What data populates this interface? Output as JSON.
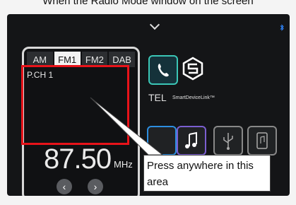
{
  "caption": "When the Radio Mode window on the screen",
  "radio": {
    "bands": [
      "AM",
      "FM1",
      "FM2",
      "DAB"
    ],
    "active_band": "FM1",
    "preset": "P.CH 1",
    "frequency": "87.50",
    "unit": "MHz",
    "prev_symbol": "‹",
    "next_symbol": "›"
  },
  "apps": {
    "tel_label": "TEL",
    "sdl_label": "SmartDeviceLink™"
  },
  "annotation": {
    "highlight_color": "#e8131a",
    "callout_text": "Press anywhere in this area"
  }
}
